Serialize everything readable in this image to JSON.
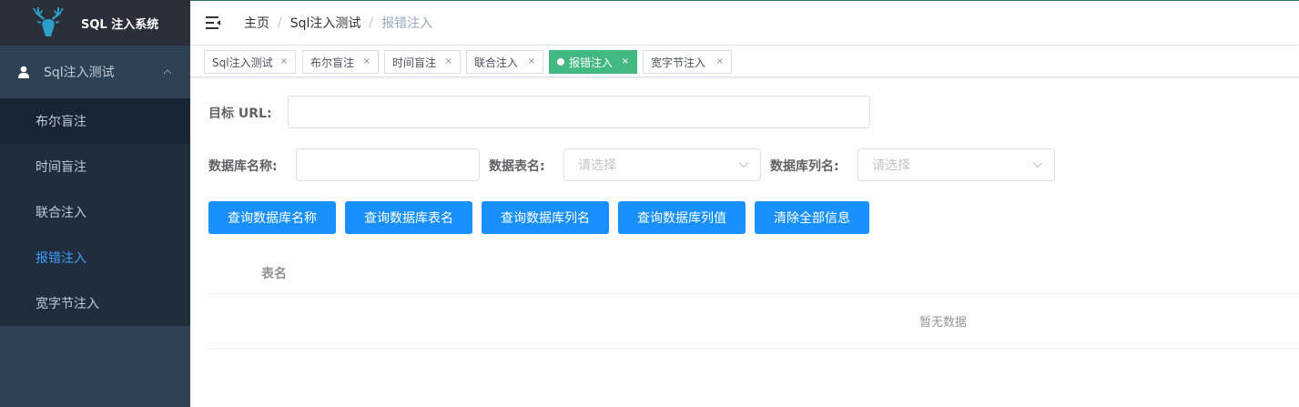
{
  "app": {
    "title": "SQL 注入系统"
  },
  "sidebar": {
    "submenu": {
      "label": "Sql注入测试",
      "icon": "user-icon"
    },
    "items": [
      {
        "label": "布尔盲注"
      },
      {
        "label": "时间盲注"
      },
      {
        "label": "联合注入"
      },
      {
        "label": "报错注入",
        "active": true
      },
      {
        "label": "宽字节注入"
      }
    ]
  },
  "header": {
    "breadcrumb": [
      "主页",
      "Sql注入测试",
      "报错注入"
    ]
  },
  "tags": [
    {
      "label": "Sql注入测试"
    },
    {
      "label": "布尔盲注"
    },
    {
      "label": "时间盲注"
    },
    {
      "label": "联合注入"
    },
    {
      "label": "报错注入",
      "active": true
    },
    {
      "label": "宽字节注入"
    }
  ],
  "form": {
    "url_label": "目标 URL:",
    "url_value": "",
    "db_label": "数据库名称:",
    "db_value": "",
    "table_label": "数据表名:",
    "table_placeholder": "请选择",
    "column_label": "数据库列名:",
    "column_placeholder": "请选择"
  },
  "buttons": {
    "query_db": "查询数据库名称",
    "query_tables": "查询数据库表名",
    "query_columns": "查询数据库列名",
    "query_values": "查询数据库列值",
    "clear_all": "清除全部信息"
  },
  "table": {
    "columns": [
      "表名"
    ],
    "empty_text": "暂无数据"
  },
  "colors": {
    "sidebar_bg": "#304156",
    "active_menu": "#409eff",
    "active_tag": "#42b983",
    "primary_button": "#1890ff"
  }
}
